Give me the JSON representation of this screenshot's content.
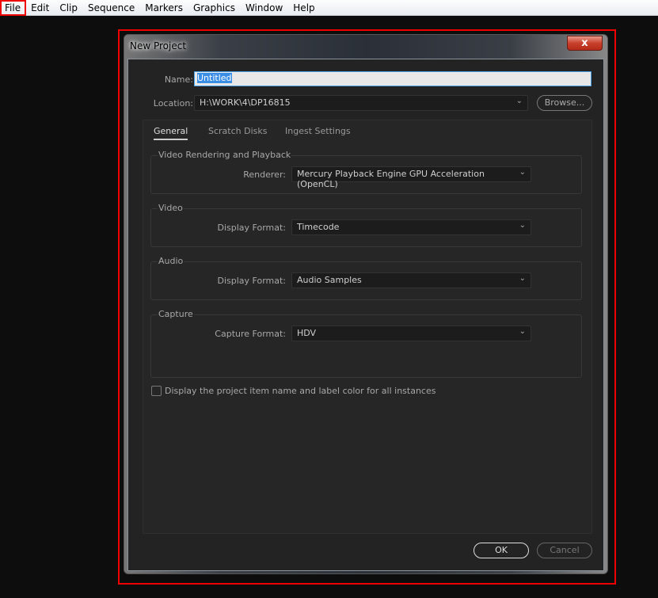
{
  "menu": [
    "File",
    "Edit",
    "Clip",
    "Sequence",
    "Markers",
    "Graphics",
    "Window",
    "Help"
  ],
  "dialog": {
    "title": "New Project",
    "close": "x",
    "name_label": "Name:",
    "name_value": "Untitled",
    "location_label": "Location:",
    "location_value": "H:\\WORK\\4\\DP16815",
    "browse": "Browse...",
    "tabs": [
      "General",
      "Scratch Disks",
      "Ingest Settings"
    ],
    "groups": {
      "rendering": {
        "title": "Video Rendering and Playback",
        "label": "Renderer:",
        "value": "Mercury Playback Engine GPU Acceleration (OpenCL)"
      },
      "video": {
        "title": "Video",
        "label": "Display Format:",
        "value": "Timecode"
      },
      "audio": {
        "title": "Audio",
        "label": "Display Format:",
        "value": "Audio Samples"
      },
      "capture": {
        "title": "Capture",
        "label": "Capture Format:",
        "value": "HDV"
      }
    },
    "checkbox": "Display the project item name and label color for all instances",
    "ok": "OK",
    "cancel": "Cancel"
  }
}
